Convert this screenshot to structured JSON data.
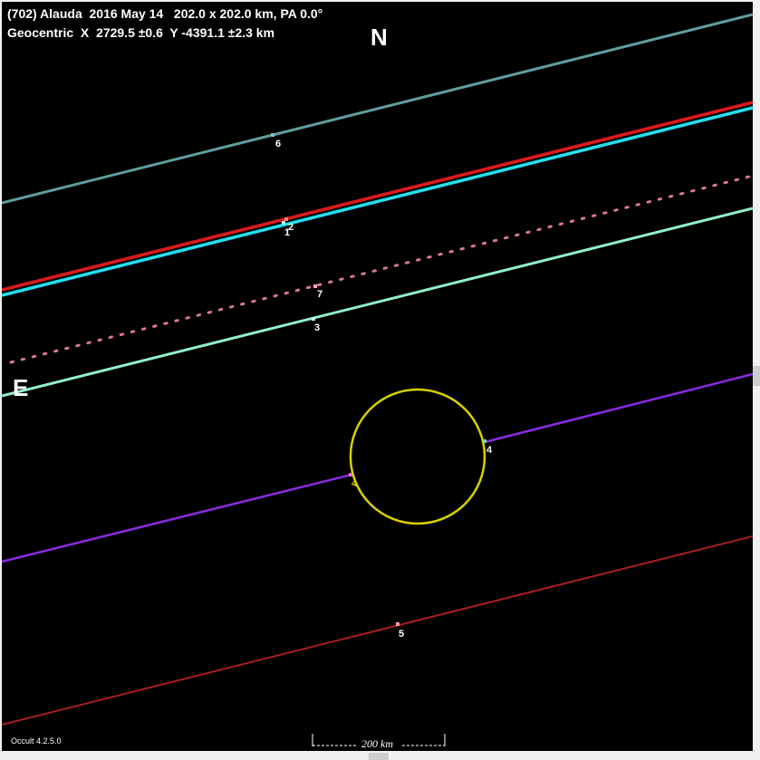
{
  "header": {
    "line1": "(702) Alauda  2016 May 14   202.0 x 202.0 km, PA 0.0°",
    "line2": "Geocentric  X  2729.5 ±0.6  Y -4391.1 ±2.3 km"
  },
  "compass": {
    "north": "N",
    "east": "E"
  },
  "footer": {
    "version": "Occult 4.2.5.0",
    "scale_label": "200 km"
  },
  "colors": {
    "background": "#000000",
    "asteroid_outline": "#d8d000",
    "chord_1": "#22e0f0",
    "chord_2": "#e01818",
    "chord_3": "#90f0c8",
    "chord_4": "#8a2be2",
    "chord_5": "#a82020",
    "chord_6": "#5f9ea0",
    "chord_7": "#d87890"
  },
  "chords": [
    {
      "id": "1",
      "label": "1",
      "color": "#22e0f0",
      "style": "miss"
    },
    {
      "id": "2",
      "label": "2",
      "color": "#e01818",
      "style": "miss"
    },
    {
      "id": "3",
      "label": "3",
      "color": "#90f0c8",
      "style": "miss"
    },
    {
      "id": "4",
      "label": "4",
      "color": "#8a2be2",
      "style": "positive"
    },
    {
      "id": "5",
      "label": "5",
      "color": "#a82020",
      "style": "miss"
    },
    {
      "id": "6",
      "label": "6",
      "color": "#5f9ea0",
      "style": "miss"
    },
    {
      "id": "7",
      "label": "7",
      "color": "#d87890",
      "style": "dotted"
    }
  ]
}
